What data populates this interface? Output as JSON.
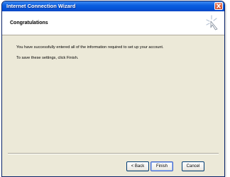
{
  "window": {
    "title": "Internet Connection Wizard"
  },
  "header": {
    "title": "Congratulations",
    "icon": "wizard-wand-icon"
  },
  "content": {
    "line1": "You have successfully entered all of the information required to set up your account.",
    "line2": "To save these settings, click Finish."
  },
  "buttons": {
    "back": "< Back",
    "finish": "Finish",
    "cancel": "Cancel"
  },
  "colors": {
    "titlebar": "#0554d8",
    "dialog_face": "#ece9d8",
    "close_button": "#cc4423"
  }
}
